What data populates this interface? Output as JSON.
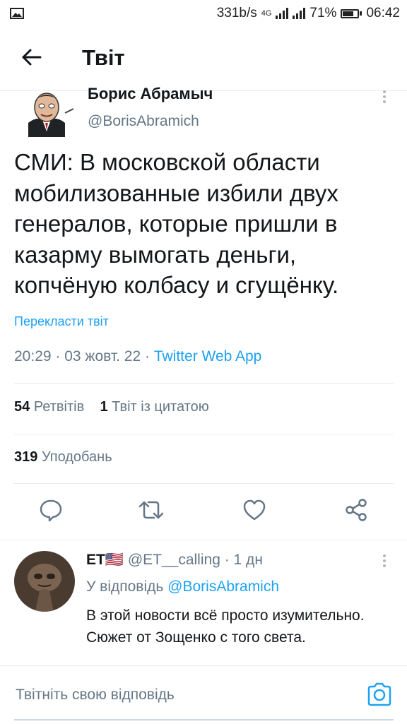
{
  "status_bar": {
    "net_speed": "331b/s",
    "network": "4G",
    "battery": "71%",
    "battery_level": 0.71,
    "time": "06:42"
  },
  "header": {
    "title": "Твіт"
  },
  "tweet": {
    "author_name": "Борис Абрамыч",
    "author_handle": "@BorisAbramich",
    "text": "СМИ: В московской области мобилизованные избили двух генералов, которые пришли в казарму вымогать деньги, копчёную колбасу и сгущёнку.",
    "translate_label": "Перекласти твіт",
    "time": "20:29",
    "date": "03 жовт. 22",
    "source": "Twitter Web App",
    "retweets_count": "54",
    "retweets_label": "Ретвітів",
    "quotes_count": "1",
    "quotes_label": "Твіт із цитатою",
    "likes_count": "319",
    "likes_label": "Уподобань"
  },
  "actions": {
    "icons": [
      "reply-icon",
      "retweet-icon",
      "like-icon",
      "share-icon"
    ],
    "color": "#657786"
  },
  "reply": {
    "name": "ET🇺🇸",
    "handle": "@ET__calling",
    "time": "1 дн",
    "reply_to_label": "У відповідь",
    "reply_to_handle": "@BorisAbramich",
    "text": "В этой новости всё просто изумительно. Сюжет от Зощенко с того света."
  },
  "compose": {
    "placeholder": "Твітніть свою відповідь",
    "camera_icon": "camera-icon"
  },
  "colors": {
    "accent": "#1da1f2",
    "secondary_text": "#657786",
    "primary_text": "#14171a"
  }
}
